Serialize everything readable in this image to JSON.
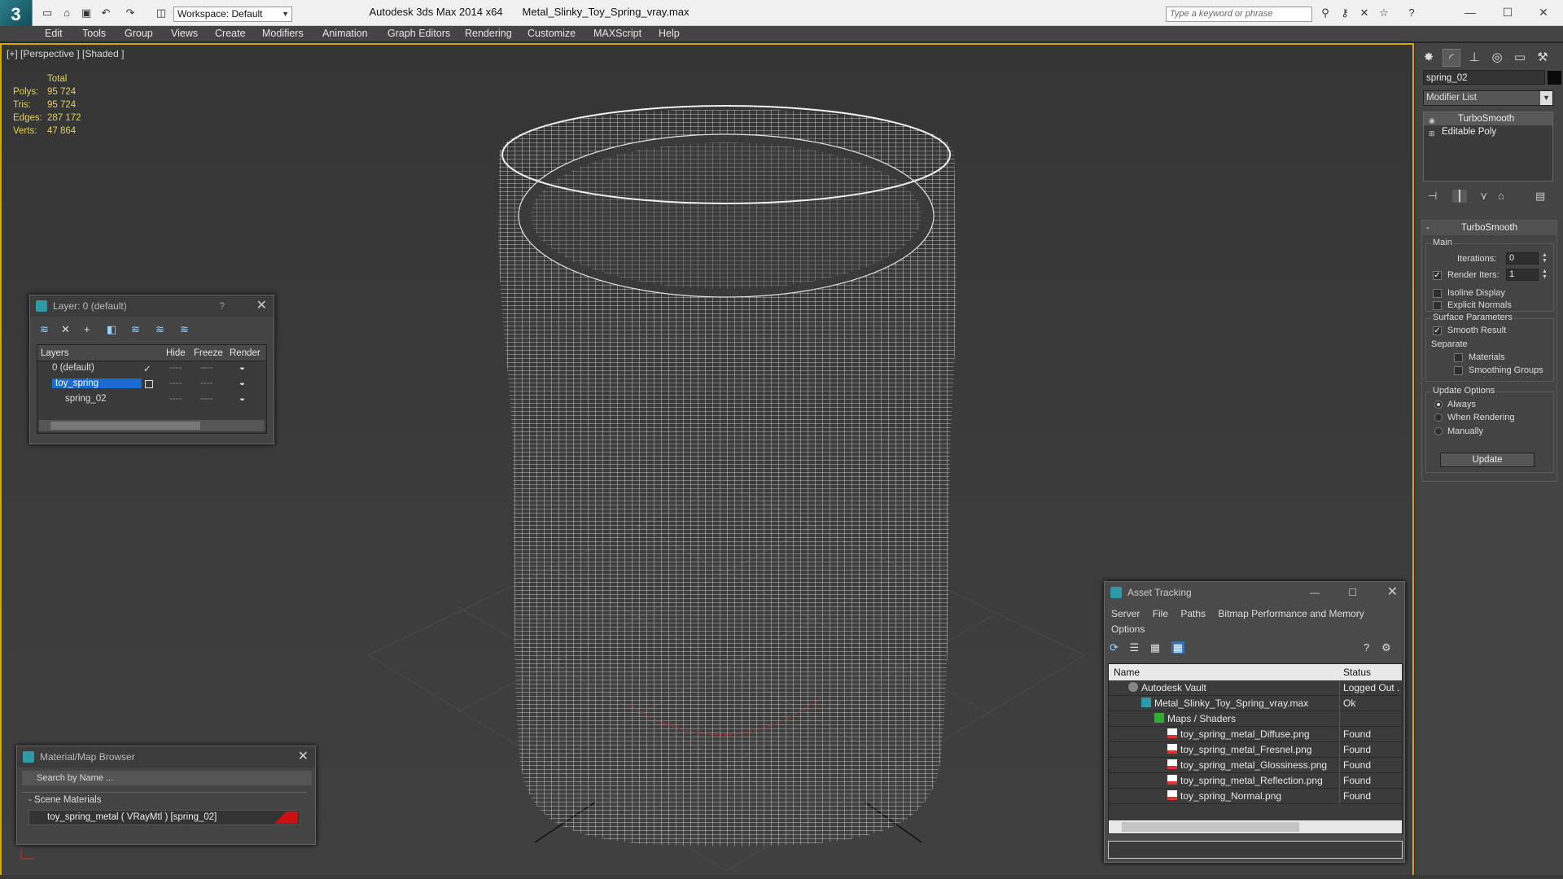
{
  "app": {
    "title": "Autodesk 3ds Max  2014 x64",
    "file": "Metal_Slinky_Toy_Spring_vray.max",
    "logo_text": "3",
    "workspace": "Workspace: Default",
    "search_placeholder": "Type a keyword or phrase"
  },
  "menu": [
    "Edit",
    "Tools",
    "Group",
    "Views",
    "Create",
    "Modifiers",
    "Animation",
    "Graph Editors",
    "Rendering",
    "Customize",
    "MAXScript",
    "Help"
  ],
  "viewport": {
    "label": "[+] [Perspective ] [Shaded ]",
    "stats": {
      "header": "Total",
      "polys_label": "Polys:",
      "polys": "95 724",
      "tris_label": "Tris:",
      "tris": "95 724",
      "edges_label": "Edges:",
      "edges": "287 172",
      "verts_label": "Verts:",
      "verts": "47 864"
    }
  },
  "layer_window": {
    "title": "Layer: 0 (default)",
    "help": "?",
    "columns": {
      "layers": "Layers",
      "hide": "Hide",
      "freeze": "Freeze",
      "render": "Render"
    },
    "rows": [
      {
        "name": "0 (default)",
        "active_mark": "✓"
      },
      {
        "name": "toy_spring"
      },
      {
        "name": "spring_02"
      }
    ],
    "dash": "----"
  },
  "material_browser": {
    "title": "Material/Map Browser",
    "search_placeholder": "Search by Name ...",
    "section": "- Scene Materials",
    "item": "toy_spring_metal  ( VRayMtl )  [spring_02]"
  },
  "asset_tracking": {
    "title": "Asset Tracking",
    "menu": [
      "Server",
      "File",
      "Paths",
      "Bitmap Performance and Memory",
      "Options"
    ],
    "columns": {
      "name": "Name",
      "status": "Status"
    },
    "rows": [
      {
        "name": "Autodesk Vault",
        "status": "Logged Out .",
        "icon": "vault"
      },
      {
        "name": "Metal_Slinky_Toy_Spring_vray.max",
        "status": "Ok",
        "icon": "max"
      },
      {
        "name": "Maps / Shaders",
        "status": "",
        "icon": "maps"
      },
      {
        "name": "toy_spring_metal_Diffuse.png",
        "status": "Found",
        "icon": "png"
      },
      {
        "name": "toy_spring_metal_Fresnel.png",
        "status": "Found",
        "icon": "png"
      },
      {
        "name": "toy_spring_metal_Glossiness.png",
        "status": "Found",
        "icon": "png"
      },
      {
        "name": "toy_spring_metal_Reflection.png",
        "status": "Found",
        "icon": "png"
      },
      {
        "name": "toy_spring_Normal.png",
        "status": "Found",
        "icon": "png"
      }
    ]
  },
  "command_panel": {
    "object_name": "spring_02",
    "modifier_list": "Modifier List",
    "stack": [
      "TurboSmooth",
      "Editable Poly"
    ],
    "rollout_title": "TurboSmooth",
    "main_group": "Main",
    "iterations_label": "Iterations:",
    "iterations": "0",
    "render_iters_label": "Render Iters:",
    "render_iters": "1",
    "isoline_label": "Isoline Display",
    "explicit_label": "Explicit Normals",
    "surface_group": "Surface Parameters",
    "smooth_result_label": "Smooth Result",
    "separate_label": "Separate",
    "materials_label": "Materials",
    "smoothing_groups_label": "Smoothing Groups",
    "update_group": "Update Options",
    "always_label": "Always",
    "when_rendering_label": "When Rendering",
    "manually_label": "Manually",
    "update_button": "Update"
  },
  "colors": {
    "viewport_border": "#d4aa00",
    "stats_text": "#e6d24e",
    "selection": "#1a6ad0",
    "material_swatch": "#cc1010"
  }
}
